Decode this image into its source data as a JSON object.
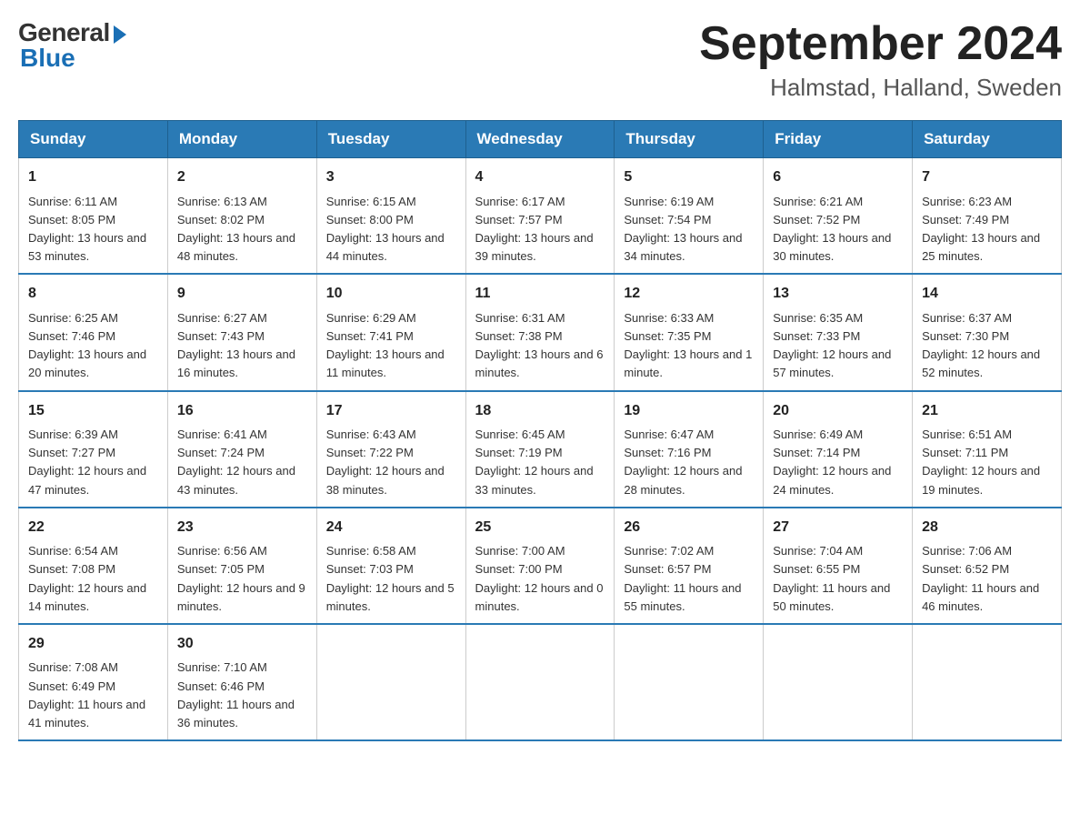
{
  "header": {
    "logo_general": "General",
    "logo_blue": "Blue",
    "title_month": "September 2024",
    "title_location": "Halmstad, Halland, Sweden"
  },
  "weekdays": [
    "Sunday",
    "Monday",
    "Tuesday",
    "Wednesday",
    "Thursday",
    "Friday",
    "Saturday"
  ],
  "weeks": [
    [
      {
        "day": "1",
        "sunrise": "6:11 AM",
        "sunset": "8:05 PM",
        "daylight": "13 hours and 53 minutes."
      },
      {
        "day": "2",
        "sunrise": "6:13 AM",
        "sunset": "8:02 PM",
        "daylight": "13 hours and 48 minutes."
      },
      {
        "day": "3",
        "sunrise": "6:15 AM",
        "sunset": "8:00 PM",
        "daylight": "13 hours and 44 minutes."
      },
      {
        "day": "4",
        "sunrise": "6:17 AM",
        "sunset": "7:57 PM",
        "daylight": "13 hours and 39 minutes."
      },
      {
        "day": "5",
        "sunrise": "6:19 AM",
        "sunset": "7:54 PM",
        "daylight": "13 hours and 34 minutes."
      },
      {
        "day": "6",
        "sunrise": "6:21 AM",
        "sunset": "7:52 PM",
        "daylight": "13 hours and 30 minutes."
      },
      {
        "day": "7",
        "sunrise": "6:23 AM",
        "sunset": "7:49 PM",
        "daylight": "13 hours and 25 minutes."
      }
    ],
    [
      {
        "day": "8",
        "sunrise": "6:25 AM",
        "sunset": "7:46 PM",
        "daylight": "13 hours and 20 minutes."
      },
      {
        "day": "9",
        "sunrise": "6:27 AM",
        "sunset": "7:43 PM",
        "daylight": "13 hours and 16 minutes."
      },
      {
        "day": "10",
        "sunrise": "6:29 AM",
        "sunset": "7:41 PM",
        "daylight": "13 hours and 11 minutes."
      },
      {
        "day": "11",
        "sunrise": "6:31 AM",
        "sunset": "7:38 PM",
        "daylight": "13 hours and 6 minutes."
      },
      {
        "day": "12",
        "sunrise": "6:33 AM",
        "sunset": "7:35 PM",
        "daylight": "13 hours and 1 minute."
      },
      {
        "day": "13",
        "sunrise": "6:35 AM",
        "sunset": "7:33 PM",
        "daylight": "12 hours and 57 minutes."
      },
      {
        "day": "14",
        "sunrise": "6:37 AM",
        "sunset": "7:30 PM",
        "daylight": "12 hours and 52 minutes."
      }
    ],
    [
      {
        "day": "15",
        "sunrise": "6:39 AM",
        "sunset": "7:27 PM",
        "daylight": "12 hours and 47 minutes."
      },
      {
        "day": "16",
        "sunrise": "6:41 AM",
        "sunset": "7:24 PM",
        "daylight": "12 hours and 43 minutes."
      },
      {
        "day": "17",
        "sunrise": "6:43 AM",
        "sunset": "7:22 PM",
        "daylight": "12 hours and 38 minutes."
      },
      {
        "day": "18",
        "sunrise": "6:45 AM",
        "sunset": "7:19 PM",
        "daylight": "12 hours and 33 minutes."
      },
      {
        "day": "19",
        "sunrise": "6:47 AM",
        "sunset": "7:16 PM",
        "daylight": "12 hours and 28 minutes."
      },
      {
        "day": "20",
        "sunrise": "6:49 AM",
        "sunset": "7:14 PM",
        "daylight": "12 hours and 24 minutes."
      },
      {
        "day": "21",
        "sunrise": "6:51 AM",
        "sunset": "7:11 PM",
        "daylight": "12 hours and 19 minutes."
      }
    ],
    [
      {
        "day": "22",
        "sunrise": "6:54 AM",
        "sunset": "7:08 PM",
        "daylight": "12 hours and 14 minutes."
      },
      {
        "day": "23",
        "sunrise": "6:56 AM",
        "sunset": "7:05 PM",
        "daylight": "12 hours and 9 minutes."
      },
      {
        "day": "24",
        "sunrise": "6:58 AM",
        "sunset": "7:03 PM",
        "daylight": "12 hours and 5 minutes."
      },
      {
        "day": "25",
        "sunrise": "7:00 AM",
        "sunset": "7:00 PM",
        "daylight": "12 hours and 0 minutes."
      },
      {
        "day": "26",
        "sunrise": "7:02 AM",
        "sunset": "6:57 PM",
        "daylight": "11 hours and 55 minutes."
      },
      {
        "day": "27",
        "sunrise": "7:04 AM",
        "sunset": "6:55 PM",
        "daylight": "11 hours and 50 minutes."
      },
      {
        "day": "28",
        "sunrise": "7:06 AM",
        "sunset": "6:52 PM",
        "daylight": "11 hours and 46 minutes."
      }
    ],
    [
      {
        "day": "29",
        "sunrise": "7:08 AM",
        "sunset": "6:49 PM",
        "daylight": "11 hours and 41 minutes."
      },
      {
        "day": "30",
        "sunrise": "7:10 AM",
        "sunset": "6:46 PM",
        "daylight": "11 hours and 36 minutes."
      },
      null,
      null,
      null,
      null,
      null
    ]
  ]
}
